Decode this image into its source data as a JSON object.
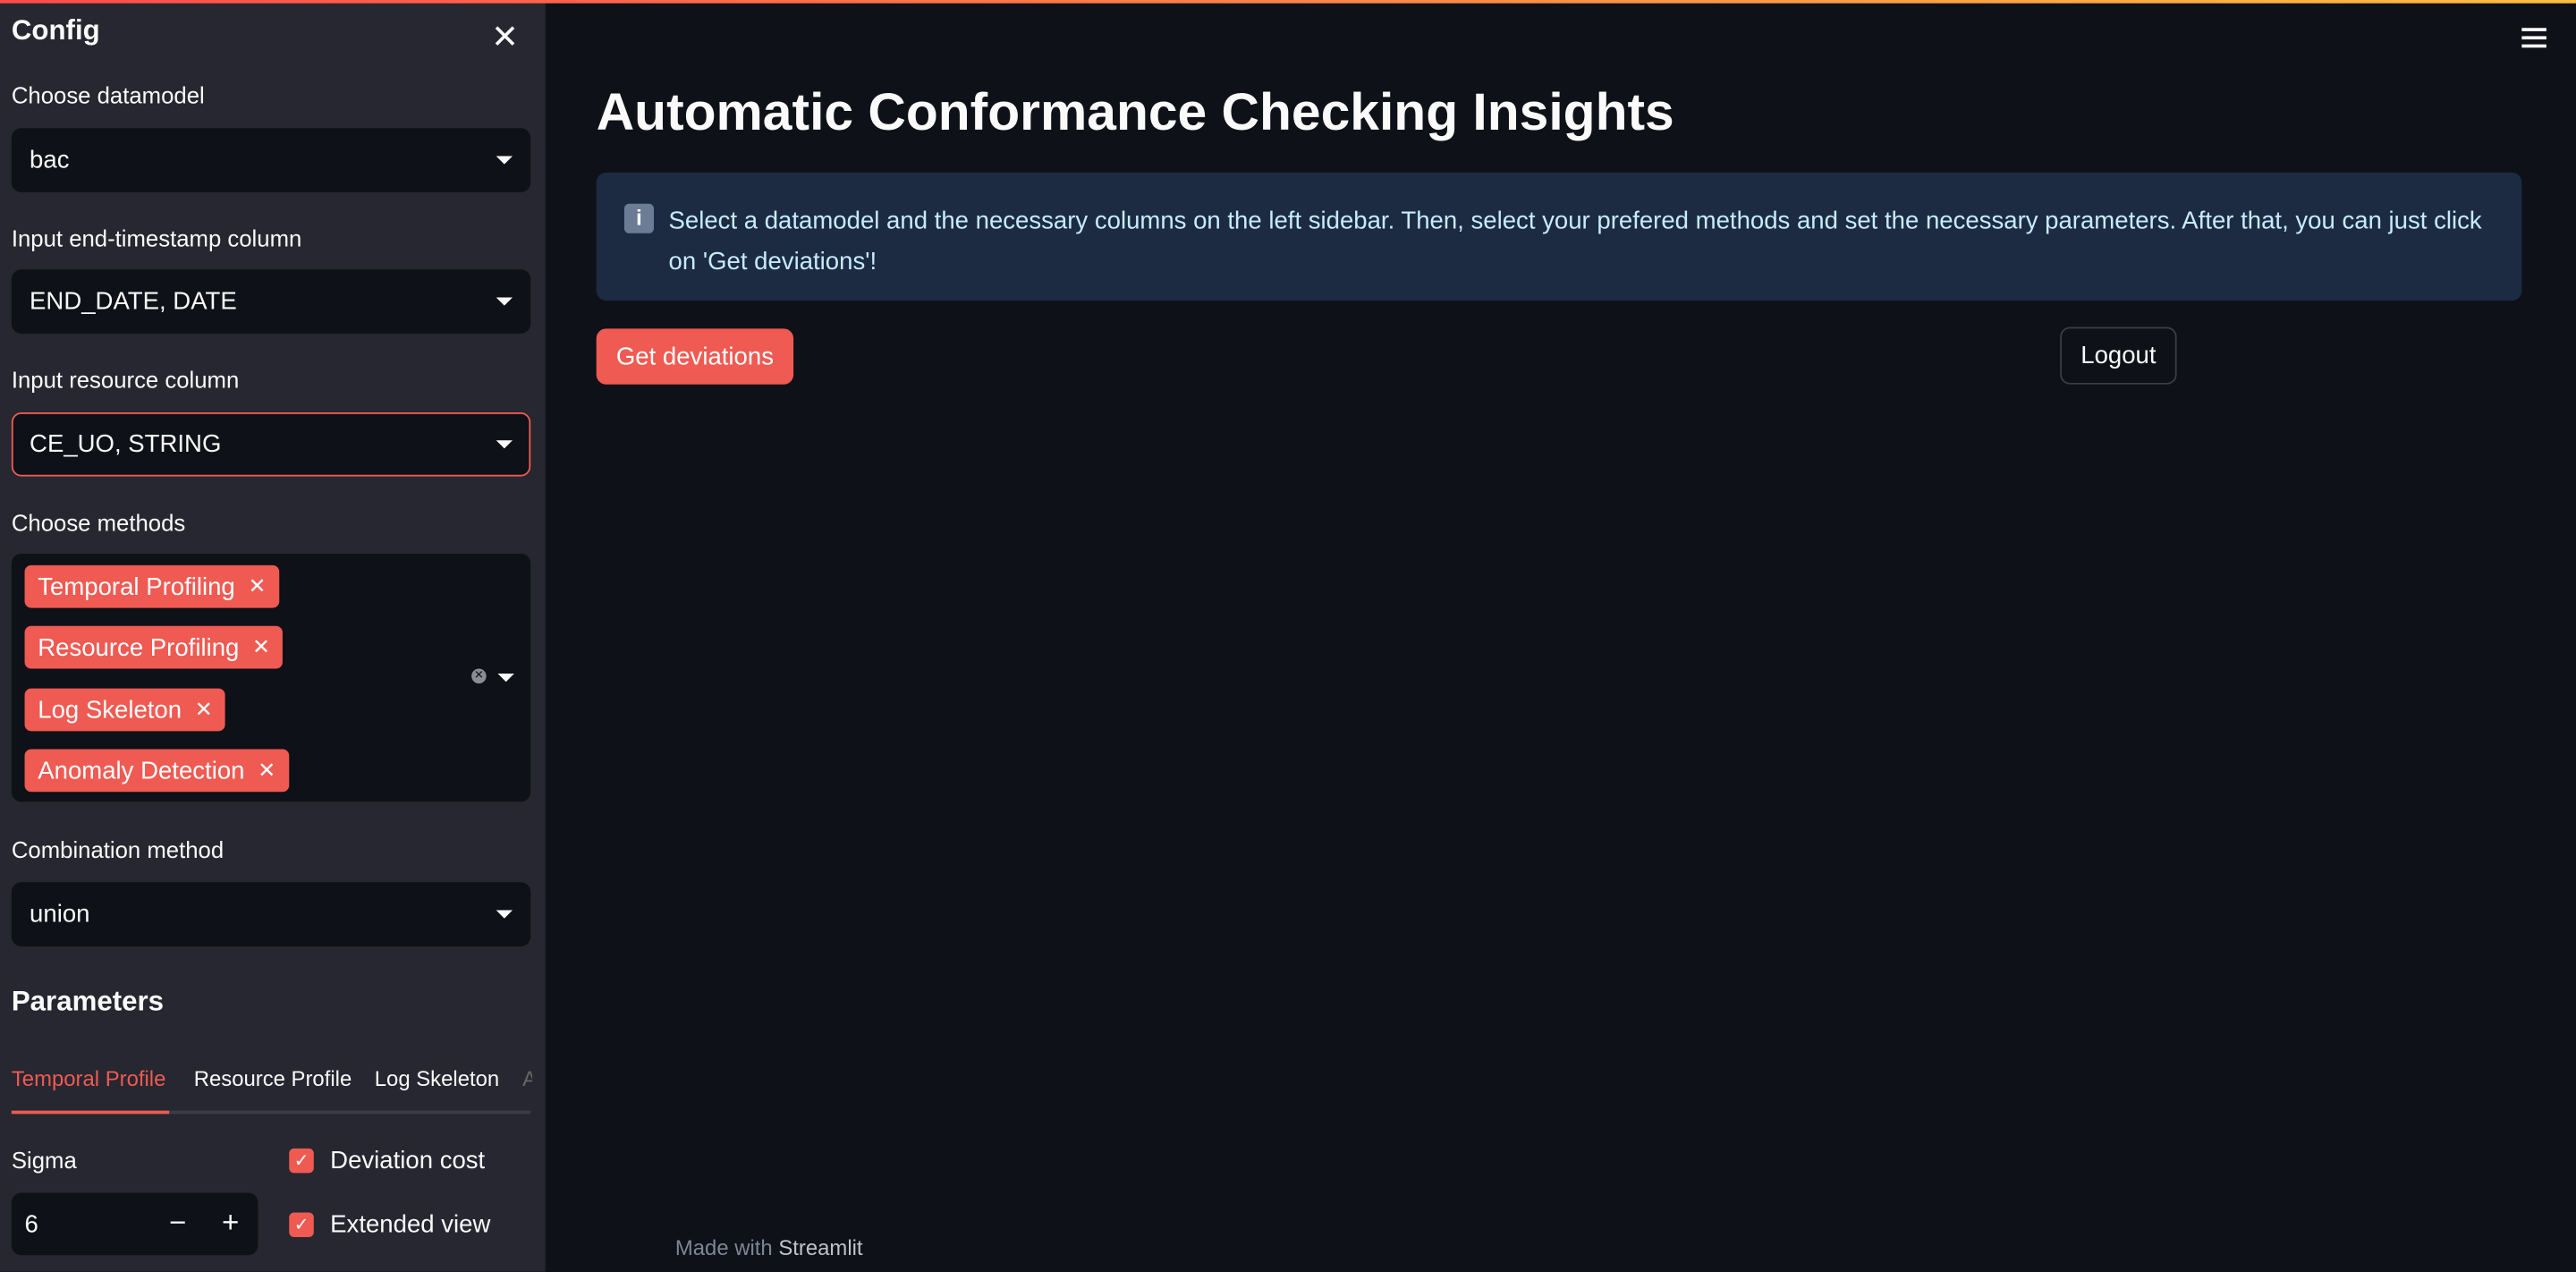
{
  "sidebar": {
    "title": "Config",
    "datamodel": {
      "label": "Choose datamodel",
      "value": "bac"
    },
    "end_timestamp": {
      "label": "Input end-timestamp column",
      "value": "END_DATE, DATE"
    },
    "resource": {
      "label": "Input resource column",
      "value": "CE_UO, STRING"
    },
    "methods": {
      "label": "Choose methods",
      "tags": [
        "Temporal Profiling",
        "Resource Profiling",
        "Log Skeleton",
        "Anomaly Detection"
      ]
    },
    "combination": {
      "label": "Combination method",
      "value": "union"
    },
    "parameters": {
      "title": "Parameters",
      "tabs": [
        "Temporal Profile",
        "Resource Profile",
        "Log Skeleton",
        "A"
      ],
      "sigma": {
        "label": "Sigma",
        "value": "6"
      },
      "checkboxes": [
        {
          "label": "Deviation cost",
          "checked": true
        },
        {
          "label": "Extended view",
          "checked": true
        }
      ]
    }
  },
  "main": {
    "title": "Automatic Conformance Checking Insights",
    "info": "Select a datamodel and the necessary columns on the left sidebar. Then, select your prefered methods and set the necessary parameters. After that, you can just click on 'Get deviations'!",
    "get_deviations": "Get deviations",
    "logout": "Logout",
    "footer_prefix": "Made with",
    "footer_brand": "Streamlit"
  },
  "colors": {
    "accent": "#ff4b4b",
    "sidebar_bg": "#262730",
    "main_bg": "#0e1117",
    "info_bg": "#1c2b41"
  }
}
